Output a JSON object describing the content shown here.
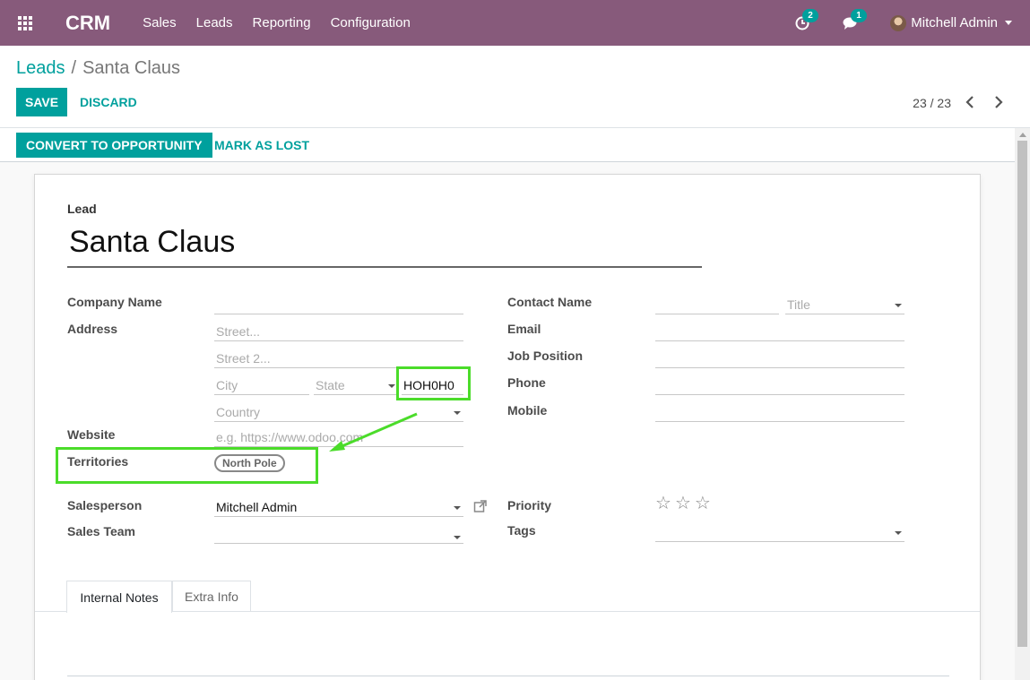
{
  "navbar": {
    "brand": "CRM",
    "menu": [
      "Sales",
      "Leads",
      "Reporting",
      "Configuration"
    ],
    "activities_count": "2",
    "messages_count": "1",
    "user_name": "Mitchell Admin"
  },
  "breadcrumb": {
    "parent": "Leads",
    "separator": "/",
    "current": "Santa Claus"
  },
  "actions": {
    "save": "SAVE",
    "discard": "DISCARD"
  },
  "pager": {
    "value": "23 / 23"
  },
  "statusbar": {
    "convert": "CONVERT TO OPPORTUNITY",
    "mark_lost": "MARK AS LOST"
  },
  "form": {
    "lead_label": "Lead",
    "name": "Santa Claus",
    "left": {
      "company_label": "Company Name",
      "company_value": "",
      "address_label": "Address",
      "street_placeholder": "Street...",
      "street2_placeholder": "Street 2...",
      "city_placeholder": "City",
      "state_placeholder": "State",
      "zip_value": "HOH0H0",
      "country_placeholder": "Country",
      "website_label": "Website",
      "website_placeholder": "e.g. https://www.odoo.com",
      "territories_label": "Territories",
      "territory_tag": "North Pole",
      "salesperson_label": "Salesperson",
      "salesperson_value": "Mitchell Admin",
      "sales_team_label": "Sales Team",
      "sales_team_value": ""
    },
    "right": {
      "contact_label": "Contact Name",
      "title_placeholder": "Title",
      "email_label": "Email",
      "job_label": "Job Position",
      "phone_label": "Phone",
      "mobile_label": "Mobile",
      "priority_label": "Priority",
      "priority_stars": 0,
      "tags_label": "Tags"
    },
    "tabs": [
      "Internal Notes",
      "Extra Info"
    ],
    "active_tab": "Internal Notes"
  },
  "colors": {
    "navbar": "#875a7b",
    "accent": "#00a09d",
    "highlight": "#4bdc2a"
  }
}
